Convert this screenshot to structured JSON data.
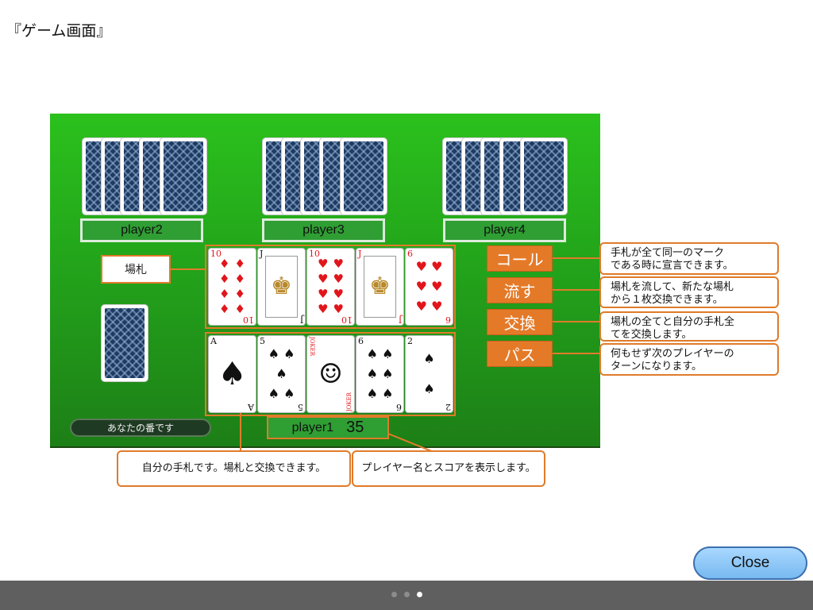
{
  "page_title": "『ゲーム画面』",
  "opponents": [
    {
      "name": "player2"
    },
    {
      "name": "player3"
    },
    {
      "name": "player4"
    }
  ],
  "field": {
    "label": "場札",
    "cards": [
      {
        "rank": "10",
        "suit": "diamond",
        "color": "red"
      },
      {
        "rank": "J",
        "suit": "spade",
        "color": "black"
      },
      {
        "rank": "10",
        "suit": "heart",
        "color": "red"
      },
      {
        "rank": "J",
        "suit": "heart",
        "color": "red"
      },
      {
        "rank": "6",
        "suit": "heart",
        "color": "red"
      }
    ]
  },
  "hand": {
    "cards": [
      {
        "rank": "A",
        "suit": "spade",
        "color": "black"
      },
      {
        "rank": "5",
        "suit": "spade",
        "color": "black"
      },
      {
        "rank": "JOKER",
        "suit": "joker",
        "color": "red"
      },
      {
        "rank": "6",
        "suit": "spade",
        "color": "black"
      },
      {
        "rank": "2",
        "suit": "spade",
        "color": "black"
      }
    ]
  },
  "player": {
    "name": "player1",
    "score": "35"
  },
  "turn_status": "あなたの番です",
  "actions": [
    {
      "label": "コール",
      "note": "手札が全て同一のマーク\nである時に宣言できます。"
    },
    {
      "label": "流す",
      "note": "場札を流して、新たな場札\nから１枚交換できます。"
    },
    {
      "label": "交換",
      "note": "場札の全てと自分の手札全\nてを交換します。"
    },
    {
      "label": "パス",
      "note": "何もせず次のプレイヤーの\nターンになります。"
    }
  ],
  "notes": {
    "hand": "自分の手札です。場札と交換できます。",
    "player": "プレイヤー名とスコアを表示します。"
  },
  "close_label": "Close",
  "pager": {
    "count": 3,
    "active": 3
  },
  "colors": {
    "table_green": "#23a41b",
    "accent_orange": "#e07b2a",
    "button_orange": "#e47a28",
    "close_blue": "#77b9f0"
  }
}
